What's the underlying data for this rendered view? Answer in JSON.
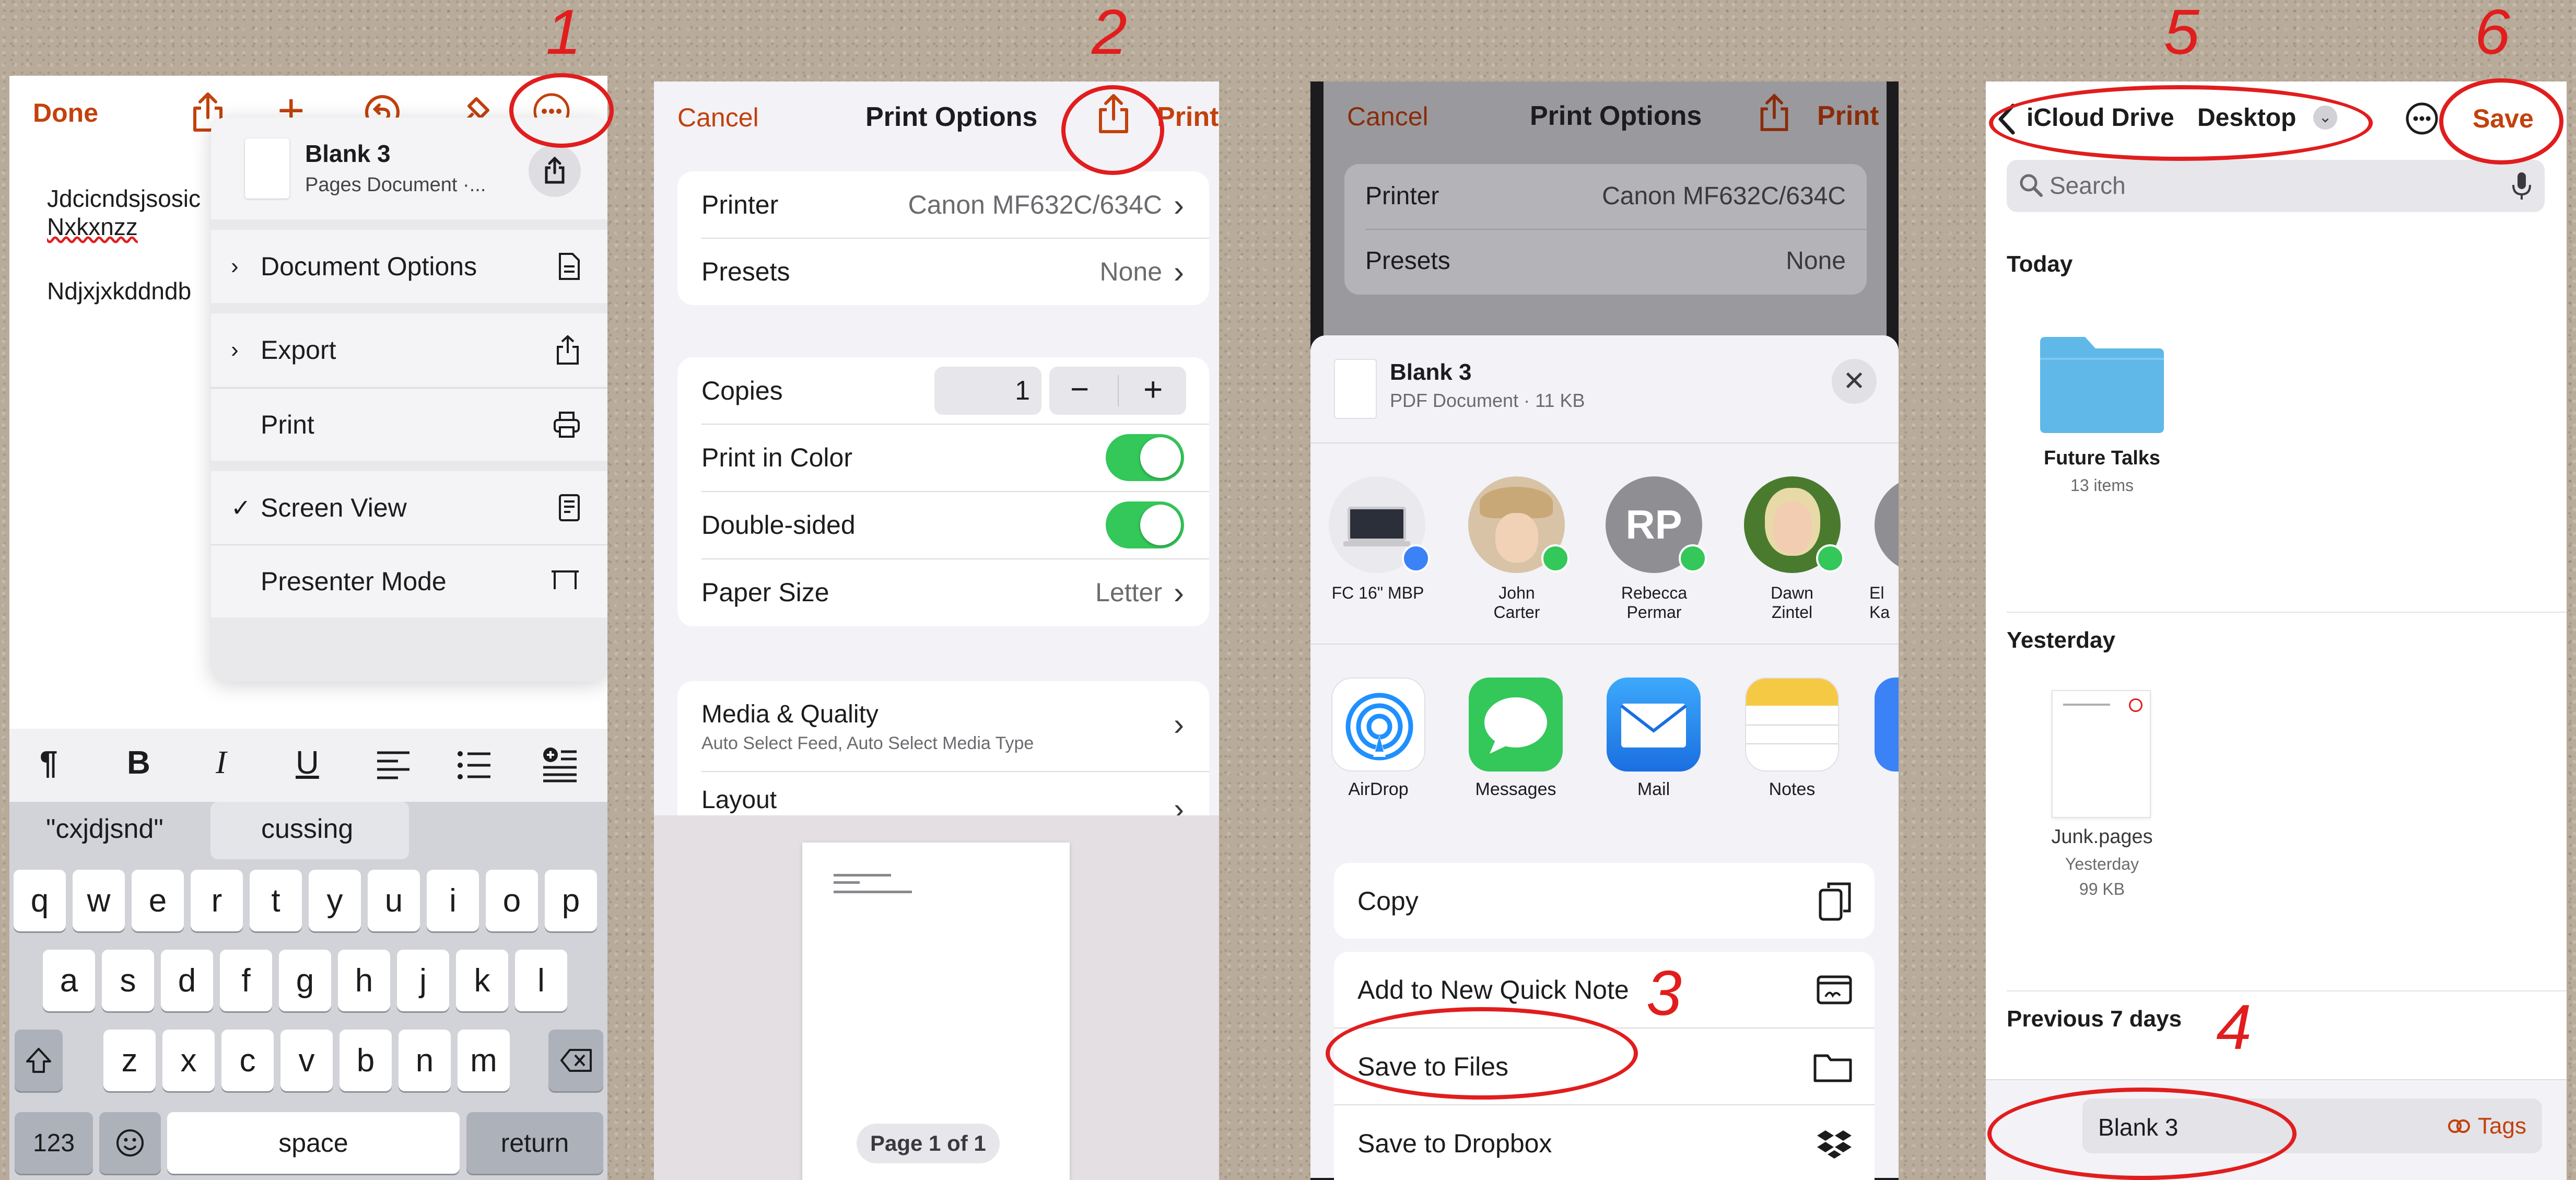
{
  "steps": [
    "1",
    "2",
    "3",
    "4",
    "5",
    "6"
  ],
  "panel1": {
    "done": "Done",
    "doc_lines": [
      "Jdcicndsjsosic",
      "Nxkxnzz",
      "Ndjxjxkddndb"
    ],
    "menu": {
      "doc_title": "Blank 3",
      "doc_subtitle": "Pages Document ·...",
      "items": [
        "Document Options",
        "Export",
        "Print",
        "Screen View",
        "Presenter Mode"
      ]
    },
    "format": {
      "para": "¶",
      "bold": "B",
      "italic": "I",
      "underline": "U"
    },
    "suggestions": [
      "\"cxjdjsnd\"",
      "cussing"
    ],
    "keys_row1": [
      "q",
      "w",
      "e",
      "r",
      "t",
      "y",
      "u",
      "i",
      "o",
      "p"
    ],
    "keys_row2": [
      "a",
      "s",
      "d",
      "f",
      "g",
      "h",
      "j",
      "k",
      "l"
    ],
    "keys_row3": [
      "z",
      "x",
      "c",
      "v",
      "b",
      "n",
      "m"
    ],
    "key_123": "123",
    "key_space": "space",
    "key_return": "return"
  },
  "panel2": {
    "cancel": "Cancel",
    "title": "Print Options",
    "print": "Print",
    "printer_label": "Printer",
    "printer_value": "Canon MF632C/634C",
    "presets_label": "Presets",
    "presets_value": "None",
    "copies_label": "Copies",
    "copies_value": "1",
    "minus": "−",
    "plus": "+",
    "color_label": "Print in Color",
    "color_on": true,
    "duplex_label": "Double-sided",
    "duplex_on": true,
    "paper_label": "Paper Size",
    "paper_value": "Letter",
    "media_label": "Media & Quality",
    "media_sub": "Auto Select Feed, Auto Select Media Type",
    "layout_label": "Layout",
    "page_badge": "Page 1 of 1"
  },
  "panel3": {
    "cancel": "Cancel",
    "title": "Print Options",
    "print": "Print",
    "printer_label": "Printer",
    "printer_value": "Canon MF632C/634C",
    "presets_label": "Presets",
    "presets_value": "None",
    "file_name": "Blank 3",
    "file_info": "PDF Document · 11 KB",
    "people": [
      {
        "name": "FC 16\" MBP"
      },
      {
        "name": "John\nCarter"
      },
      {
        "name": "Rebecca\nPermar",
        "initials": "RP"
      },
      {
        "name": "Dawn\nZintel"
      },
      {
        "name": "El\nKa"
      }
    ],
    "apps": [
      "AirDrop",
      "Messages",
      "Mail",
      "Notes"
    ],
    "actions": [
      "Copy",
      "Add to New Quick Note",
      "Save to Files",
      "Save to Dropbox"
    ]
  },
  "panel4": {
    "back": "iCloud Drive",
    "folder": "Desktop",
    "save": "Save",
    "search_placeholder": "Search",
    "sections": [
      "Today",
      "Yesterday",
      "Previous 7 days"
    ],
    "folder_item": {
      "name": "Future Talks",
      "info": "13 items"
    },
    "file_item": {
      "name": "Junk.pages",
      "date": "Yesterday",
      "size": "99 KB"
    },
    "filename": "Blank 3",
    "tags": "Tags"
  },
  "colors": {
    "accent": "#c2410c",
    "annotation": "#e11d1d",
    "toggle": "#34c759",
    "folder": "#5fb8e8"
  }
}
